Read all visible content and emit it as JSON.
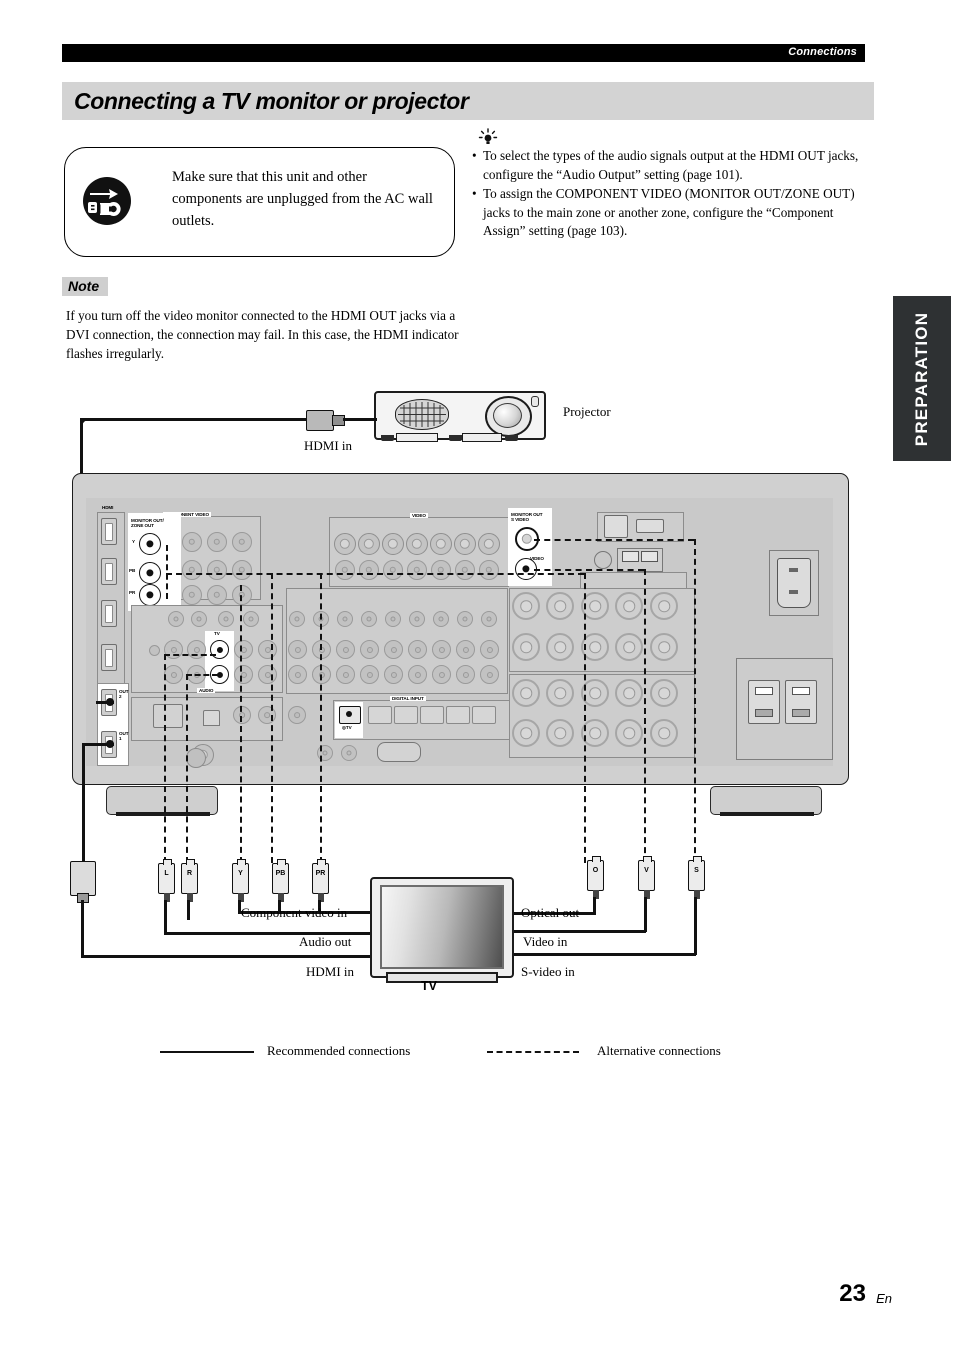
{
  "header": {
    "running_head": "Connections"
  },
  "section": {
    "title": "Connecting a TV monitor or projector"
  },
  "caution": {
    "icon": "unplug-power-icon",
    "text": "Make sure that this unit and other components are unplugged from the AC wall outlets."
  },
  "tips": {
    "icon": "tip-bulb-icon",
    "bullet": "•",
    "items": [
      "To select the types of the audio signals output at the HDMI OUT jacks, configure the “Audio Output” setting (page 101).",
      "To assign the COMPONENT VIDEO (MONITOR OUT/ZONE OUT) jacks to the main zone or another zone, configure the “Component Assign” setting (page 103)."
    ]
  },
  "note": {
    "label": "Note",
    "text": "If you turn off the video monitor connected to the HDMI OUT jacks via a DVI connection, the connection may fail. In this case, the HDMI indicator flashes irregularly."
  },
  "side_tab": {
    "label": "PREPARATION"
  },
  "diagram": {
    "projector": {
      "device_label": "Projector",
      "port_label": "HDMI in"
    },
    "tv": {
      "device_label": "TV",
      "left_ports": [
        "Component video in",
        "Audio out",
        "HDMI in"
      ],
      "right_ports": [
        "Optical out",
        "Video in",
        "S-video in"
      ]
    },
    "panel_labels": {
      "hdmi": "HDMI",
      "component_video": "COMPONENT VIDEO",
      "monitor_out_zone_out": "MONITOR OUT/\nZONE OUT",
      "y": "Y",
      "pb": "PB",
      "pr": "PR",
      "video": "VIDEO",
      "monitor_out_s_video": "MONITOR OUT\nS VIDEO",
      "monitor_out_video": "VIDEO",
      "tv": "TV",
      "audio": "AUDIO",
      "digital_input": "DIGITAL INPUT",
      "digital_tv": "TV",
      "hdmi_out_2_line1": "OUT",
      "hdmi_out_2_line2": "2",
      "hdmi_out_1_line1": "OUT",
      "hdmi_out_1_line2": "1"
    },
    "plugs": {
      "hdmi": "",
      "audio_left": "L",
      "audio_right": "R",
      "comp_y": "Y",
      "comp_pb": "PB",
      "comp_pr": "PR",
      "optical": "O",
      "video": "V",
      "svideo": "S"
    }
  },
  "legend": {
    "recommended": "Recommended connections",
    "alternative": "Alternative connections"
  },
  "footer": {
    "page_number": "23",
    "language": "En"
  },
  "colors": {
    "header_bar": "#000000",
    "section_bar": "#d3d3d3",
    "note_label_bg": "#cfcfcf",
    "side_tab_bg": "#2e3133",
    "chassis": "#d0d0d0",
    "wire": "#111111"
  }
}
